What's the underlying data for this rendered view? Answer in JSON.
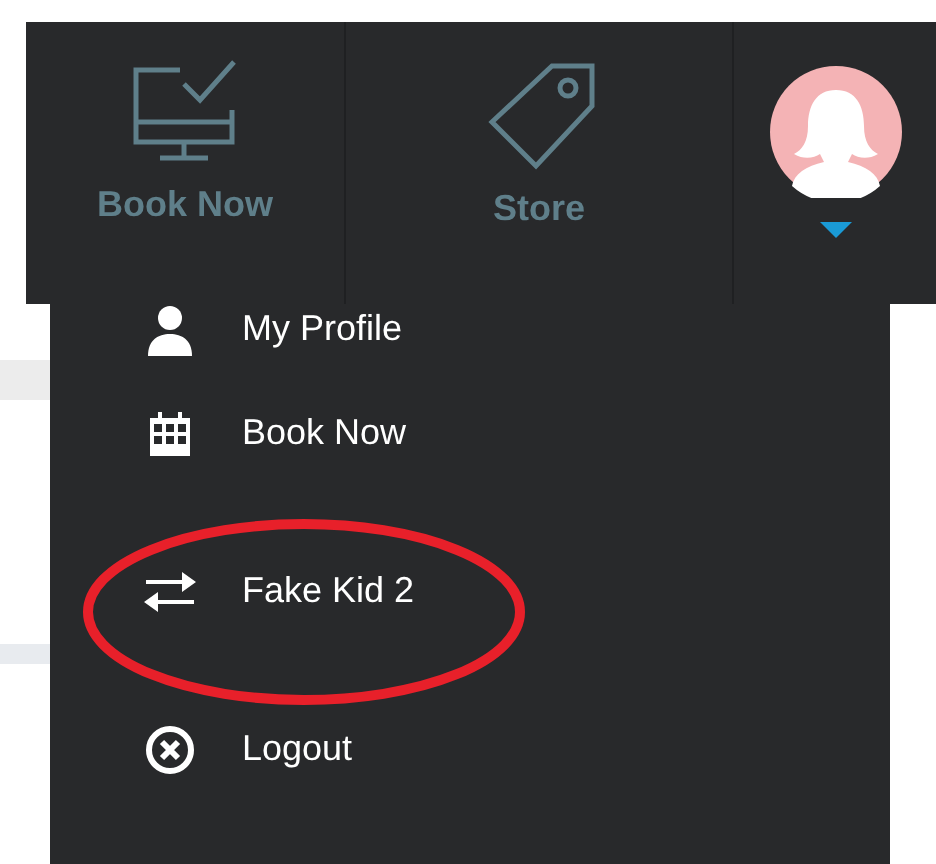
{
  "nav": [
    {
      "kind": "monitor",
      "label": "Book Now"
    },
    {
      "kind": "tag",
      "label": "Store"
    }
  ],
  "account_menu": {
    "expanded": true,
    "items": [
      {
        "kind": "profile",
        "label": "My Profile",
        "circled": false
      },
      {
        "kind": "calendar",
        "label": "Book Now",
        "circled": false
      },
      {
        "kind": "switch",
        "label": "Fake Kid 2",
        "circled": true
      },
      {
        "kind": "logout",
        "label": "Logout",
        "circled": false
      }
    ]
  }
}
